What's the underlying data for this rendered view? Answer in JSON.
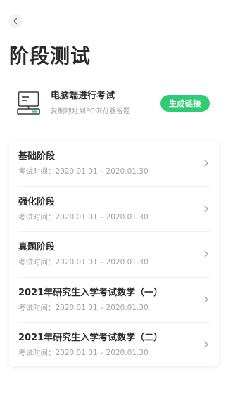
{
  "header": {
    "back_icon": "chevron-left-icon",
    "title": "阶段测试"
  },
  "pc_exam": {
    "icon": "computer-icon",
    "title": "电脑端进行考试",
    "subtitle": "复制地址到PC浏览器答题",
    "button_label": "生成链接",
    "button_color": "#2fcb75"
  },
  "stages": [
    {
      "name": "基础阶段",
      "time": "考试时间：2020.01.01 – 2020.01.30"
    },
    {
      "name": "强化阶段",
      "time": "考试时间：2020.01.01 – 2020.01.30"
    },
    {
      "name": "真题阶段",
      "time": "考试时间：2020.01.01 – 2020.01.30"
    },
    {
      "name": "2021年研究生入学考试数学（一）",
      "time": "考试时间：2020.01.01 – 2020.01.30"
    },
    {
      "name": "2021年研究生入学考试数学（二）",
      "time": "考试时间：2020.01.01 – 2020.01.30"
    }
  ]
}
